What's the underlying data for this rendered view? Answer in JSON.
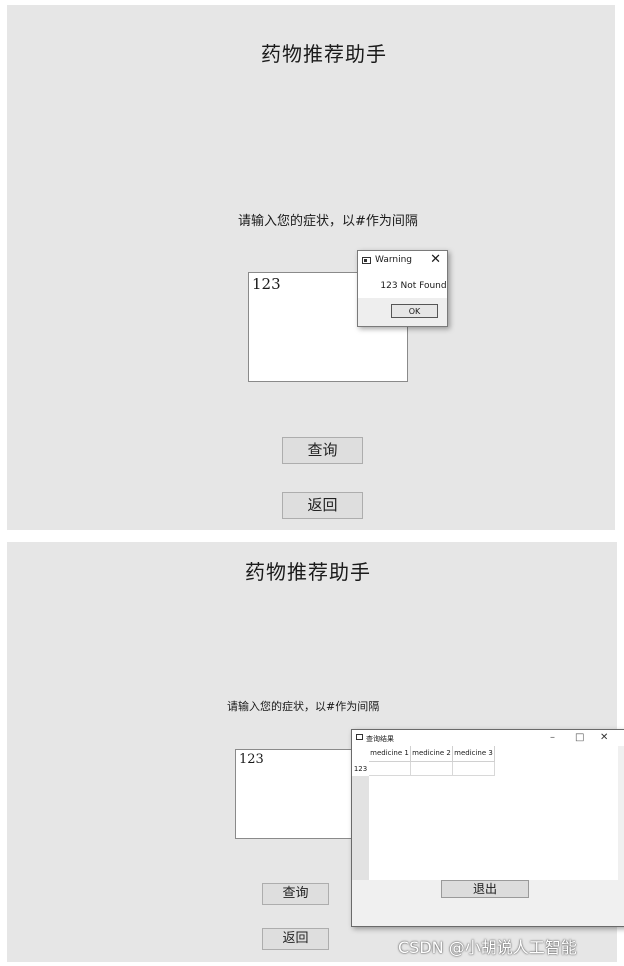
{
  "screen1": {
    "title": "药物推荐助手",
    "prompt": "请输入您的症状，以#作为间隔",
    "input_value": "123",
    "query_button": "查询",
    "back_button": "返回",
    "warning": {
      "title": "Warning",
      "close": "✕",
      "message": "123 Not Found",
      "ok": "OK"
    }
  },
  "screen2": {
    "title": "药物推荐助手",
    "prompt": "请输入您的症状，以#作为间隔",
    "input_value": "123",
    "query_button": "查询",
    "back_button": "返回",
    "result_window": {
      "title": "查询结果",
      "minimize": "–",
      "maximize": "□",
      "close": "✕",
      "columns": [
        "medicine 1",
        "medicine 2",
        "medicine 3"
      ],
      "row_label": "123",
      "exit_button": "退出"
    }
  },
  "watermark": "CSDN @小胡说人工智能"
}
